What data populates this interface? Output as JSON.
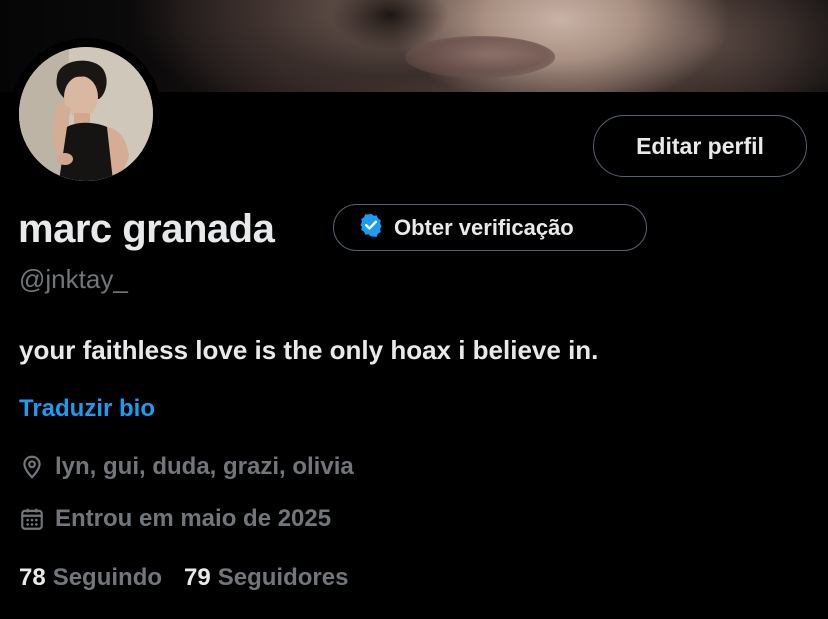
{
  "profile": {
    "display_name": "marc granada",
    "handle": "@jnktay_",
    "bio": "your faithless love is the only hoax i believe in.",
    "translate_label": "Traduzir bio",
    "location": "lyn, gui, duda, grazi, olivia",
    "joined": "Entrou em maio de 2025",
    "following_count": "78",
    "following_label": "Seguindo",
    "followers_count": "79",
    "followers_label": "Seguidores"
  },
  "buttons": {
    "edit_profile": "Editar perfil",
    "get_verified": "Obter verificação"
  },
  "icons": {
    "verified": "verified-badge-icon",
    "location": "location-pin-icon",
    "calendar": "calendar-icon"
  },
  "colors": {
    "background": "#000000",
    "text_primary": "#e7e9ea",
    "text_secondary": "#71767b",
    "accent": "#1d9bf0",
    "border": "#536471"
  }
}
